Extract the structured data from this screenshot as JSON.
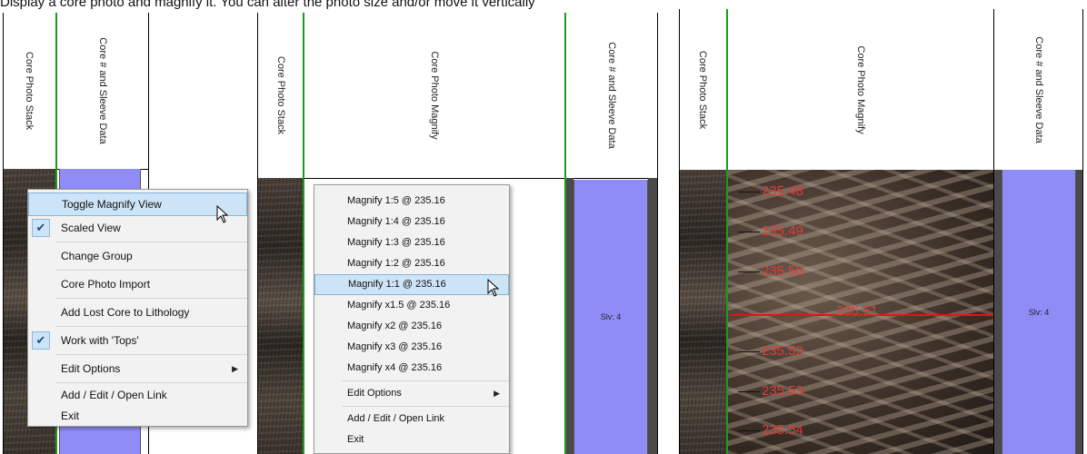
{
  "caption": "Display a core photo and magnify it. You can alter the photo size and/or move it vertically",
  "headers": {
    "core_photo_stack": "Core Photo Stack",
    "core_sleeve_data": "Core # and Sleeve Data",
    "core_photo_magnify": "Core Photo Magnify"
  },
  "sleeve_label": "Slv: 4",
  "menu1": {
    "items": [
      {
        "label": "Toggle Magnify View",
        "checked": false
      },
      {
        "label": "Scaled View",
        "checked": true
      },
      {
        "label": "Change Group",
        "checked": false
      },
      {
        "label": "Core Photo Import",
        "checked": false
      },
      {
        "label": "Add Lost Core to Lithology",
        "checked": false
      },
      {
        "label": "Work with 'Tops'",
        "checked": true
      },
      {
        "label": "Edit Options",
        "checked": false,
        "submenu": true
      },
      {
        "label": "Add / Edit / Open Link",
        "checked": false
      },
      {
        "label": "Exit",
        "checked": false
      }
    ]
  },
  "menu2": {
    "items": [
      "Magnify 1:5 @ 235.16",
      "Magnify 1:4 @ 235.16",
      "Magnify 1:3 @ 235.16",
      "Magnify 1:2 @ 235.16",
      "Magnify 1:1 @ 235.16",
      "Magnify x1.5 @ 235.16",
      "Magnify x2 @ 235.16",
      "Magnify x3 @ 235.16",
      "Magnify x4 @ 235.16",
      "Edit Options",
      "Add / Edit / Open Link",
      "Exit"
    ],
    "highlighted_index": 4
  },
  "depths": [
    "235.48",
    "235.49",
    "235.50",
    "235.51",
    "235.52",
    "235.53",
    "235.54"
  ],
  "colors": {
    "sleeve": "#8f8cf5",
    "highlight": "#cde4f7",
    "depth_text": "#e33a3a",
    "track_line": "#1c9b1c"
  }
}
